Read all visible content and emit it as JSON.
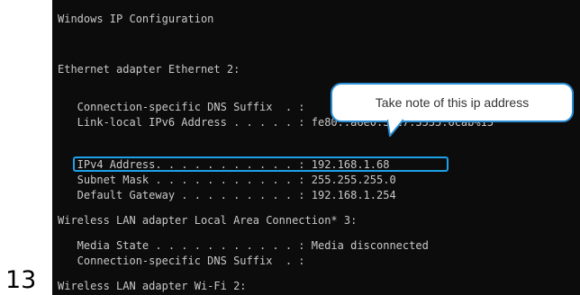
{
  "step": "13",
  "console": {
    "lines": {
      "title": "Windows IP Configuration",
      "eth_header": "Ethernet adapter Ethernet 2:",
      "dns_suffix": "   Connection-specific DNS Suffix  . :",
      "link_local": "   Link-local IPv6 Address . . . . . : fe80::a6e0:36c7:3535:6cab%15",
      "ipv4": "   IPv4 Address. . . . . . . . . . . : 192.168.1.68",
      "subnet": "   Subnet Mask . . . . . . . . . . . : 255.255.255.0",
      "gateway": "   Default Gateway . . . . . . . . . : 192.168.1.254",
      "wireless_local_header": "Wireless LAN adapter Local Area Connection* 3:",
      "media_state": "   Media State . . . . . . . . . . . : Media disconnected",
      "dns_suffix_2": "   Connection-specific DNS Suffix  . :",
      "wifi_header": "Wireless LAN adapter Wi-Fi 2:"
    }
  },
  "callout": {
    "text": "Take note of this ip address"
  },
  "colors": {
    "console_bg": "#0c0c0c",
    "console_text": "#c9c9c9",
    "highlight": "#1ea1e8",
    "callout_border": "#2a8fd6"
  }
}
